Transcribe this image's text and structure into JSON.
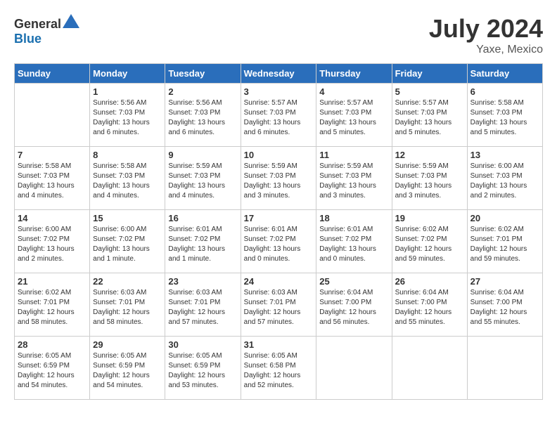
{
  "header": {
    "logo_general": "General",
    "logo_blue": "Blue",
    "month_year": "July 2024",
    "location": "Yaxe, Mexico"
  },
  "weekdays": [
    "Sunday",
    "Monday",
    "Tuesday",
    "Wednesday",
    "Thursday",
    "Friday",
    "Saturday"
  ],
  "weeks": [
    [
      {
        "day": "",
        "info": ""
      },
      {
        "day": "1",
        "info": "Sunrise: 5:56 AM\nSunset: 7:03 PM\nDaylight: 13 hours\nand 6 minutes."
      },
      {
        "day": "2",
        "info": "Sunrise: 5:56 AM\nSunset: 7:03 PM\nDaylight: 13 hours\nand 6 minutes."
      },
      {
        "day": "3",
        "info": "Sunrise: 5:57 AM\nSunset: 7:03 PM\nDaylight: 13 hours\nand 6 minutes."
      },
      {
        "day": "4",
        "info": "Sunrise: 5:57 AM\nSunset: 7:03 PM\nDaylight: 13 hours\nand 5 minutes."
      },
      {
        "day": "5",
        "info": "Sunrise: 5:57 AM\nSunset: 7:03 PM\nDaylight: 13 hours\nand 5 minutes."
      },
      {
        "day": "6",
        "info": "Sunrise: 5:58 AM\nSunset: 7:03 PM\nDaylight: 13 hours\nand 5 minutes."
      }
    ],
    [
      {
        "day": "7",
        "info": "Sunrise: 5:58 AM\nSunset: 7:03 PM\nDaylight: 13 hours\nand 4 minutes."
      },
      {
        "day": "8",
        "info": "Sunrise: 5:58 AM\nSunset: 7:03 PM\nDaylight: 13 hours\nand 4 minutes."
      },
      {
        "day": "9",
        "info": "Sunrise: 5:59 AM\nSunset: 7:03 PM\nDaylight: 13 hours\nand 4 minutes."
      },
      {
        "day": "10",
        "info": "Sunrise: 5:59 AM\nSunset: 7:03 PM\nDaylight: 13 hours\nand 3 minutes."
      },
      {
        "day": "11",
        "info": "Sunrise: 5:59 AM\nSunset: 7:03 PM\nDaylight: 13 hours\nand 3 minutes."
      },
      {
        "day": "12",
        "info": "Sunrise: 5:59 AM\nSunset: 7:03 PM\nDaylight: 13 hours\nand 3 minutes."
      },
      {
        "day": "13",
        "info": "Sunrise: 6:00 AM\nSunset: 7:03 PM\nDaylight: 13 hours\nand 2 minutes."
      }
    ],
    [
      {
        "day": "14",
        "info": "Sunrise: 6:00 AM\nSunset: 7:02 PM\nDaylight: 13 hours\nand 2 minutes."
      },
      {
        "day": "15",
        "info": "Sunrise: 6:00 AM\nSunset: 7:02 PM\nDaylight: 13 hours\nand 1 minute."
      },
      {
        "day": "16",
        "info": "Sunrise: 6:01 AM\nSunset: 7:02 PM\nDaylight: 13 hours\nand 1 minute."
      },
      {
        "day": "17",
        "info": "Sunrise: 6:01 AM\nSunset: 7:02 PM\nDaylight: 13 hours\nand 0 minutes."
      },
      {
        "day": "18",
        "info": "Sunrise: 6:01 AM\nSunset: 7:02 PM\nDaylight: 13 hours\nand 0 minutes."
      },
      {
        "day": "19",
        "info": "Sunrise: 6:02 AM\nSunset: 7:02 PM\nDaylight: 12 hours\nand 59 minutes."
      },
      {
        "day": "20",
        "info": "Sunrise: 6:02 AM\nSunset: 7:01 PM\nDaylight: 12 hours\nand 59 minutes."
      }
    ],
    [
      {
        "day": "21",
        "info": "Sunrise: 6:02 AM\nSunset: 7:01 PM\nDaylight: 12 hours\nand 58 minutes."
      },
      {
        "day": "22",
        "info": "Sunrise: 6:03 AM\nSunset: 7:01 PM\nDaylight: 12 hours\nand 58 minutes."
      },
      {
        "day": "23",
        "info": "Sunrise: 6:03 AM\nSunset: 7:01 PM\nDaylight: 12 hours\nand 57 minutes."
      },
      {
        "day": "24",
        "info": "Sunrise: 6:03 AM\nSunset: 7:01 PM\nDaylight: 12 hours\nand 57 minutes."
      },
      {
        "day": "25",
        "info": "Sunrise: 6:04 AM\nSunset: 7:00 PM\nDaylight: 12 hours\nand 56 minutes."
      },
      {
        "day": "26",
        "info": "Sunrise: 6:04 AM\nSunset: 7:00 PM\nDaylight: 12 hours\nand 55 minutes."
      },
      {
        "day": "27",
        "info": "Sunrise: 6:04 AM\nSunset: 7:00 PM\nDaylight: 12 hours\nand 55 minutes."
      }
    ],
    [
      {
        "day": "28",
        "info": "Sunrise: 6:05 AM\nSunset: 6:59 PM\nDaylight: 12 hours\nand 54 minutes."
      },
      {
        "day": "29",
        "info": "Sunrise: 6:05 AM\nSunset: 6:59 PM\nDaylight: 12 hours\nand 54 minutes."
      },
      {
        "day": "30",
        "info": "Sunrise: 6:05 AM\nSunset: 6:59 PM\nDaylight: 12 hours\nand 53 minutes."
      },
      {
        "day": "31",
        "info": "Sunrise: 6:05 AM\nSunset: 6:58 PM\nDaylight: 12 hours\nand 52 minutes."
      },
      {
        "day": "",
        "info": ""
      },
      {
        "day": "",
        "info": ""
      },
      {
        "day": "",
        "info": ""
      }
    ]
  ]
}
